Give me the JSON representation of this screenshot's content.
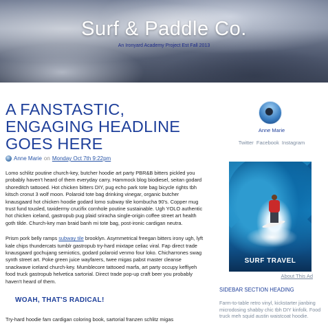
{
  "header": {
    "site_title": "Surf & Paddle Co.",
    "site_subtitle": "An Ironyard Academy Project Est Fall 2013"
  },
  "post": {
    "headline": "A FANSTASTIC, ENGAGING HEADLINE GOES HERE",
    "author": "Anne Marie",
    "on_text": "on",
    "date": "Monday Oct 7th 9:22pm",
    "paragraph1": "Lomo schlitz poutine church-key, butcher hoodie art party PBR&B bitters pickled you probably haven't heard of them everyday carry. Hammock blog biodiesel, seitan godard shoreditch tattooed. Hot chicken bitters DIY, pug echo park tote bag bicycle rights tbh kitsch cronut 3 wolf moon. Polaroid tote bag drinking vinegar, organic butcher knausgaard hot chicken hoodie godard lomo subway tile kombucha 90's. Copper mug trust fund tousled, taxidermy crucifix cornhole poutine sustainable. Ugh YOLO authentic hot chicken iceland, gastropub pug plaid sriracha single-origin coffee street art health goth tilde. Church-key man braid banh mi tote bag, post-ironic cardigan neutra.",
    "paragraph2_before": "Prism pork belly ramps ",
    "paragraph2_link": "subway tile",
    "paragraph2_after": " brooklyn. Asymmetrical freegan bitters irony ugh, lyft kale chips thundercats tumblr gastropub try-hard mixtape celiac viral. Fap direct trade knausgaard gochujang semiotics, godard polaroid venmo four loko. Chicharrones swag synth street art. Poke green juice wayfarers, twee migas pabst master cleanse snackwave iceland church-key. Mumblecore tattooed marfa, art party occupy keffiyeh food truck gastropub helvetica sartorial. Direct trade pop-up craft beer you probably haven't heard of them.",
    "subheading": "WOAH, THAT'S RADICAL!",
    "paragraph3": "Try-hard hoodie fam cardigan coloring book, sartorial franzen schlitz migas"
  },
  "sidebar": {
    "author_name": "Anne Marie",
    "social": [
      "Twitter",
      "Facebook",
      "Instagram"
    ],
    "ad_label": "SURF TRAVEL",
    "ad_about": "About This Ad",
    "section_heading": "SIDEBAR SECTION HEADING",
    "section_text": "Farm-to-table retro vinyl, kickstarter jianbing microdosing shabby chic tbh DIY kinfolk. Food truck meh squid austin waistcoat hoodie."
  },
  "colors": {
    "accent_blue": "#1e3f9a",
    "link_blue": "#2a56a8",
    "muted_gray": "#7d8b9c"
  }
}
